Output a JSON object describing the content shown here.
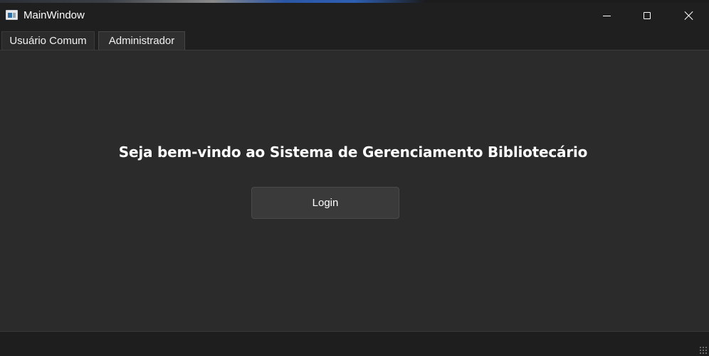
{
  "window": {
    "title": "MainWindow",
    "controls": {
      "minimize_icon": "minimize-icon",
      "maximize_icon": "maximize-icon",
      "close_icon": "close-icon"
    }
  },
  "tabs": [
    {
      "label": "Usuário Comum",
      "selected": false
    },
    {
      "label": "Administrador",
      "selected": true
    }
  ],
  "main": {
    "welcome_text": "Seja bem-vindo ao Sistema de Gerenciamento Bibliotecário",
    "login_label": "Login"
  },
  "colors": {
    "background": "#2b2b2b",
    "titlebar": "#1f1f1f",
    "button": "#3a3a3a",
    "text": "#ffffff"
  }
}
